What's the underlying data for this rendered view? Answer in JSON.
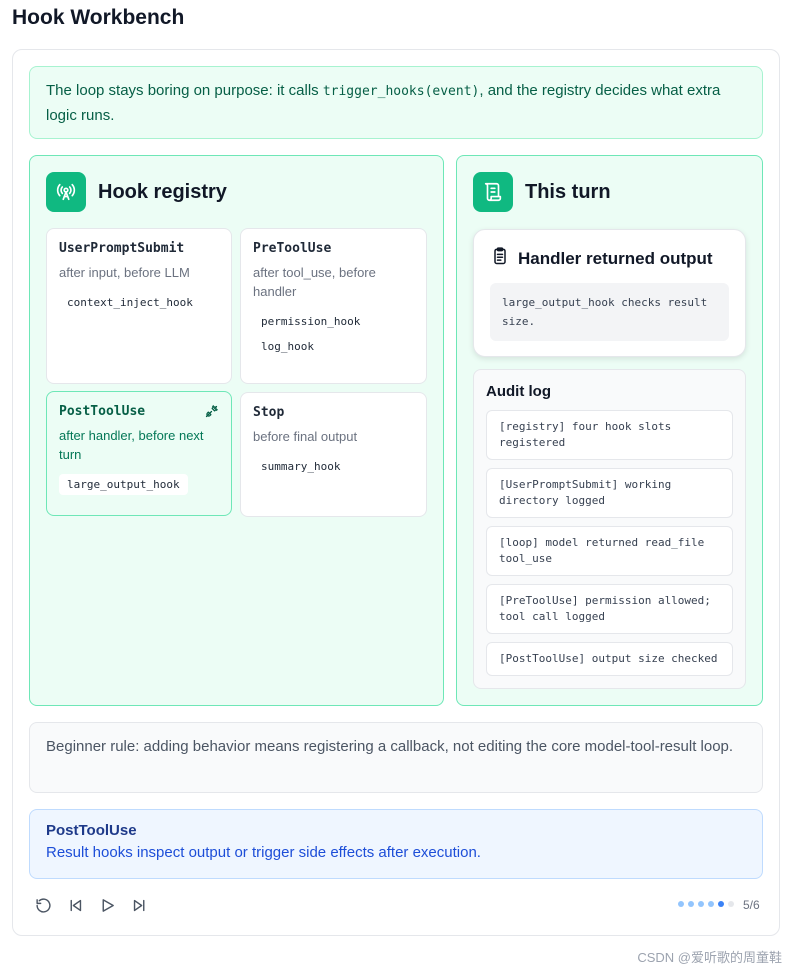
{
  "page": {
    "title": "Hook Workbench"
  },
  "intro": {
    "text_before": "The loop stays boring on purpose: it calls ",
    "code": "trigger_hooks(event)",
    "text_after": ", and the registry decides what extra logic runs."
  },
  "registry": {
    "title": "Hook registry",
    "icon": "broadcast-icon",
    "slots": [
      {
        "name": "UserPromptSubmit",
        "desc": "after input, before LLM",
        "hooks": [
          "context_inject_hook"
        ],
        "active": false
      },
      {
        "name": "PreToolUse",
        "desc": "after tool_use, before handler",
        "hooks": [
          "permission_hook",
          "log_hook"
        ],
        "active": false
      },
      {
        "name": "PostToolUse",
        "desc": "after handler, before next turn",
        "hooks": [
          "large_output_hook"
        ],
        "active": true,
        "icon": "plug-icon"
      },
      {
        "name": "Stop",
        "desc": "before final output",
        "hooks": [
          "summary_hook"
        ],
        "active": false
      }
    ]
  },
  "turn": {
    "title": "This turn",
    "icon": "scroll-icon",
    "handler": {
      "title": "Handler returned output",
      "icon": "clipboard-icon",
      "body": "large_output_hook checks result size."
    },
    "audit": {
      "title": "Audit log",
      "items": [
        "[registry] four hook slots registered",
        "[UserPromptSubmit] working directory logged",
        "[loop] model returned read_file tool_use",
        "[PreToolUse] permission allowed; tool call logged",
        "[PostToolUse] output size checked"
      ]
    }
  },
  "rule": {
    "text": "Beginner rule: adding behavior means registering a callback, not editing the core model-tool-result loop."
  },
  "step": {
    "title": "PostToolUse",
    "desc": "Result hooks inspect output or trigger side effects after execution."
  },
  "controls": {
    "icons": [
      "reset-icon",
      "skip-back-icon",
      "play-icon",
      "skip-forward-icon"
    ],
    "current_step": 5,
    "total_steps": 6,
    "counter": "5/6"
  },
  "colors": {
    "accent": "#10b981",
    "panel_bg": "#ecfdf5",
    "info_blue": "#1d4ed8"
  },
  "watermark": "CSDN @爱听歌的周童鞋"
}
